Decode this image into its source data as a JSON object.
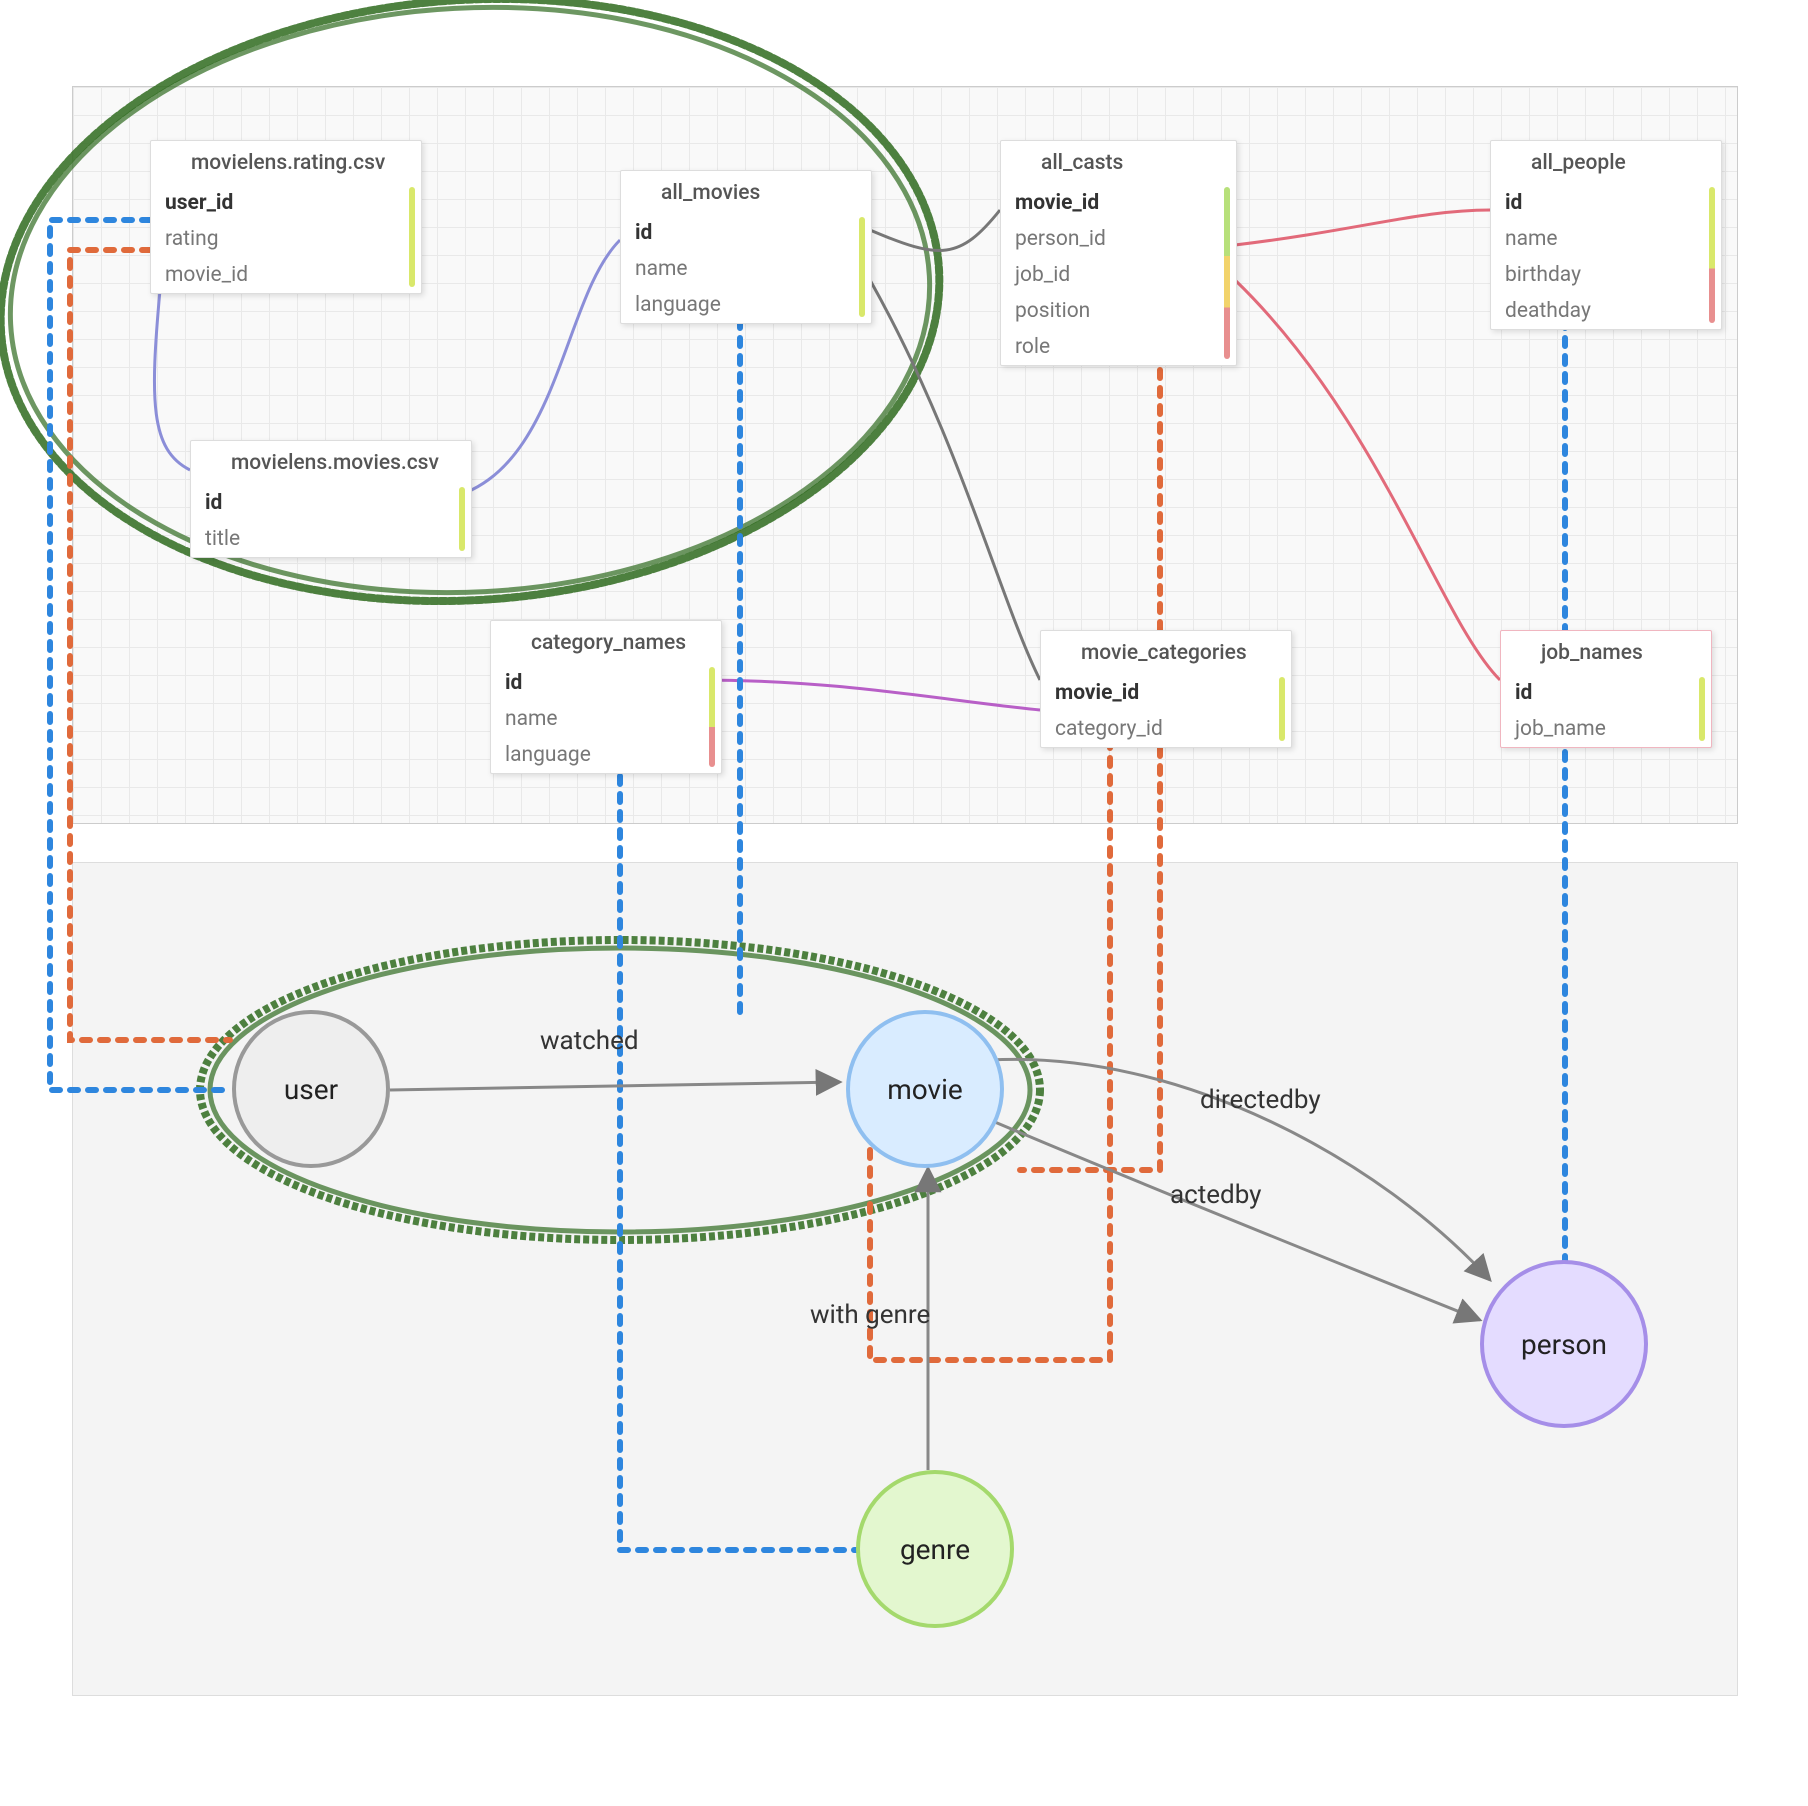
{
  "tables": {
    "ratings": {
      "title": "movielens.rating.csv",
      "fields": [
        "user_id",
        "rating",
        "movie_id"
      ],
      "keys": [
        "user_id"
      ],
      "stripe": "#d9e86b"
    },
    "movies_csv": {
      "title": "movielens.movies.csv",
      "fields": [
        "id",
        "title"
      ],
      "keys": [
        "id"
      ],
      "stripe": "#d9e86b"
    },
    "all_movies": {
      "title": "all_movies",
      "fields": [
        "id",
        "name",
        "language"
      ],
      "keys": [
        "id"
      ],
      "stripe": "#d9e86b"
    },
    "all_casts": {
      "title": "all_casts",
      "fields": [
        "movie_id",
        "person_id",
        "job_id",
        "position",
        "role"
      ],
      "keys": [
        "movie_id"
      ],
      "stripe": "#b7e07a,#f2d36b,#e88f8f"
    },
    "all_people": {
      "title": "all_people",
      "fields": [
        "id",
        "name",
        "birthday",
        "deathday"
      ],
      "keys": [
        "id"
      ],
      "stripe": "#d9e86b,#e88f8f"
    },
    "category_names": {
      "title": "category_names",
      "fields": [
        "id",
        "name",
        "language"
      ],
      "keys": [
        "id"
      ],
      "stripe": "#d9e86b,#e88f8f"
    },
    "movie_categories": {
      "title": "movie_categories",
      "fields": [
        "movie_id",
        "category_id"
      ],
      "keys": [
        "movie_id"
      ],
      "stripe": "#d9e86b"
    },
    "job_names": {
      "title": "job_names",
      "fields": [
        "id",
        "job_name"
      ],
      "keys": [
        "id"
      ],
      "stripe": "#d9e86b"
    }
  },
  "nodes": {
    "user": "user",
    "movie": "movie",
    "genre": "genre",
    "person": "person"
  },
  "edges": {
    "watched": "watched",
    "with_genre": "with genre",
    "directedby": "directedby",
    "actedby": "actedby"
  },
  "annotation_color": "#2f6b1f",
  "dotted_colors": {
    "blue": "#2e86de",
    "orange": "#e06a3b"
  }
}
